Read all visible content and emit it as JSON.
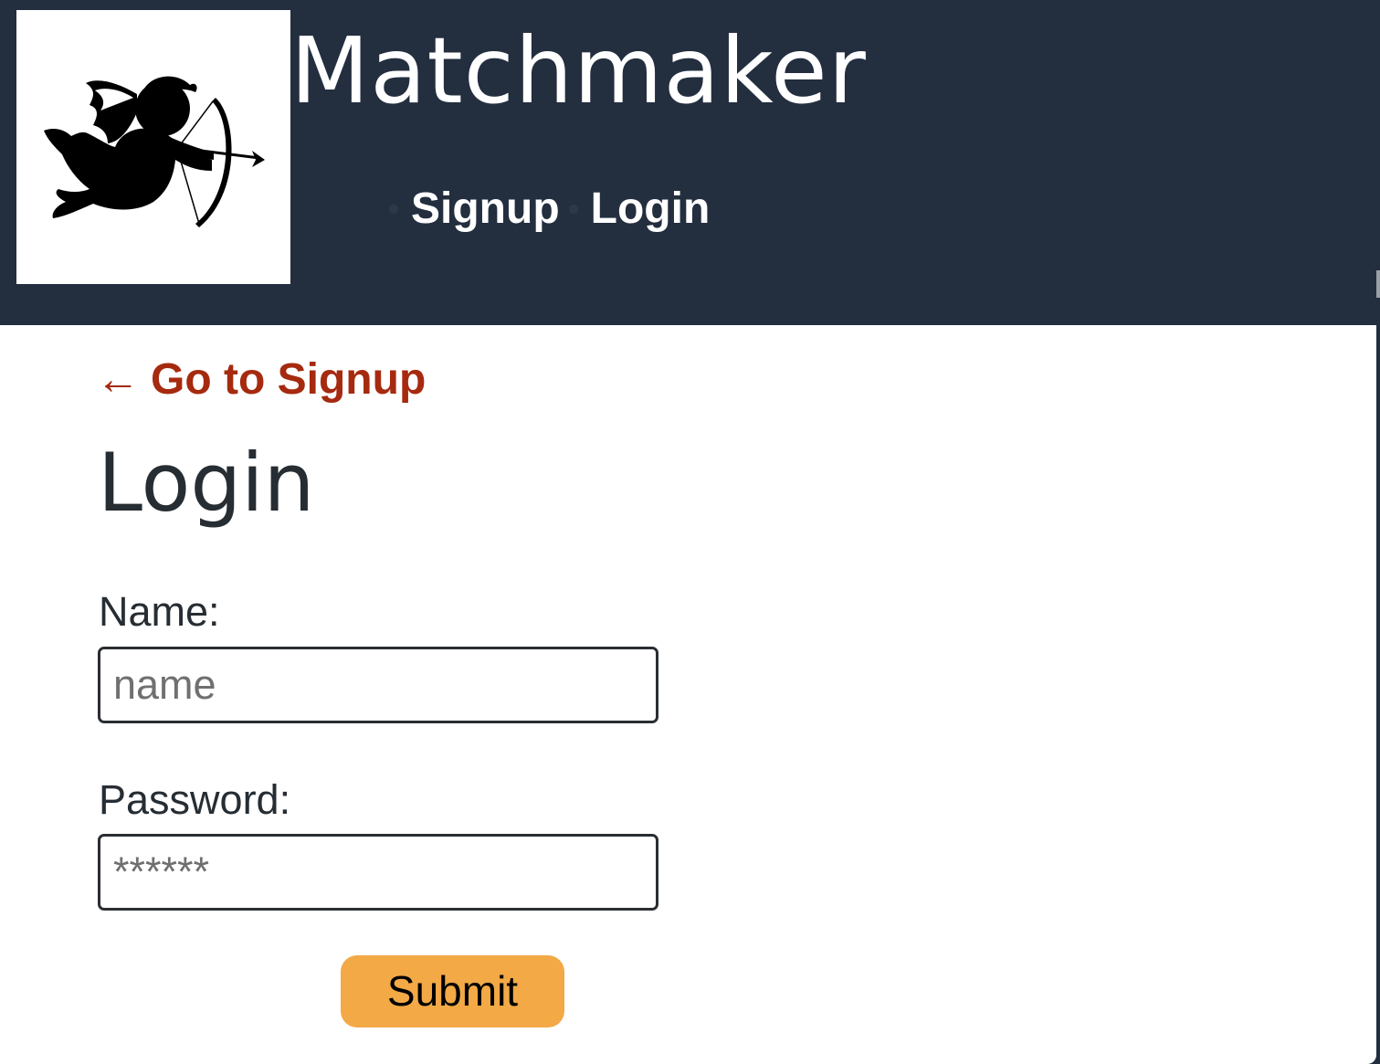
{
  "header": {
    "logo_icon": "cupid-icon",
    "title": "Matchmaker",
    "nav": [
      {
        "label": "Signup"
      },
      {
        "label": "Login"
      }
    ]
  },
  "main": {
    "back_link": {
      "arrow": "←",
      "label": "Go to Signup"
    },
    "page_title": "Login",
    "form": {
      "name_label": "Name:",
      "name_placeholder": "name",
      "name_value": "",
      "password_label": "Password:",
      "password_placeholder": "******",
      "password_value": "",
      "submit_label": "Submit"
    }
  },
  "colors": {
    "header_bg": "#232e3f",
    "link": "#a52a0f",
    "submit_bg": "#f2a946",
    "text": "#262d33"
  }
}
